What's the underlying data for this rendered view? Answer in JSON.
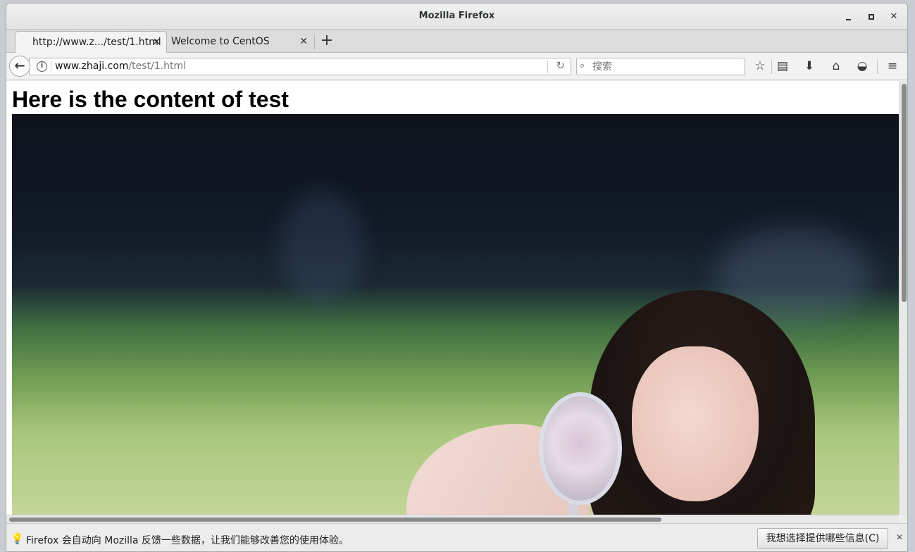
{
  "window": {
    "title": "Mozilla Firefox"
  },
  "tabs": [
    {
      "label": "http://www.z.../test/1.html",
      "active": true
    },
    {
      "label": "Welcome to CentOS",
      "active": false
    }
  ],
  "new_tab_label": "+",
  "urlbar": {
    "url_host": "www.zhaji.com",
    "url_path": "/test/1.html"
  },
  "search": {
    "placeholder": "搜索"
  },
  "page": {
    "heading": "Here is the content of test"
  },
  "notification": {
    "message": "Firefox 会自动向 Mozilla 反馈一些数据，让我们能够改善您的使用体验。",
    "button_label": "我想选择提供哪些信息(C)"
  },
  "icons": {
    "back": "back-arrow-icon",
    "info": "info-icon",
    "reload": "reload-icon",
    "search": "search-icon",
    "bookmark": "star-icon",
    "library": "clipboard-icon",
    "download": "download-icon",
    "home": "home-icon",
    "pocket": "pocket-icon",
    "menu": "hamburger-icon"
  }
}
